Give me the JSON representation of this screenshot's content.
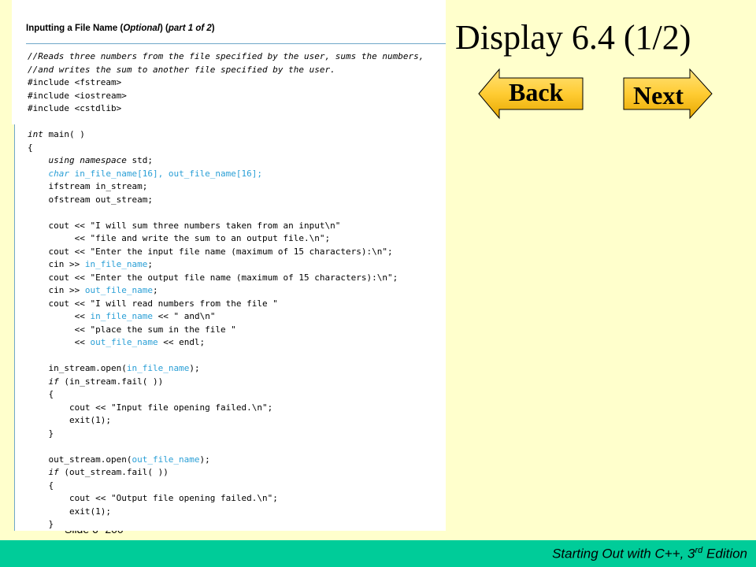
{
  "slide": {
    "number_label": "Slide 6- 200",
    "title": "Display 6.4 (1/2)",
    "back_label": "Back",
    "next_label": "Next"
  },
  "footer": {
    "text_main": "Starting Out with C++, 3",
    "text_sup": "rd",
    "text_end": " Edition"
  },
  "colors": {
    "slide_background": "#FFFFCC",
    "footer_band": "#00CC99",
    "button_fill": "#FFCC33",
    "code_highlight": "#2a9fd6",
    "rule": "#6fa7c9"
  },
  "icons": {
    "back_button_shape": "left-arrow-icon",
    "next_button_shape": "right-arrow-icon"
  },
  "panel": {
    "title_plain": "Inputting a File Name ",
    "title_paren_open": "(",
    "title_optional": "Optional",
    "title_paren_close": ") (",
    "title_part": "part 1 of 2",
    "title_end": ")"
  },
  "code_lines": [
    [
      {
        "t": "//Reads three numbers from the file specified by the user, sums the numbers,",
        "s": "kw"
      }
    ],
    [
      {
        "t": "//and writes the sum to another file specified by the user.",
        "s": "kw"
      }
    ],
    [
      {
        "t": "#include <fstream>"
      }
    ],
    [
      {
        "t": "#include <iostream>"
      }
    ],
    [
      {
        "t": "#include <cstdlib>"
      }
    ],
    [],
    [
      {
        "t": "int",
        "s": "kw"
      },
      {
        "t": " main( )"
      }
    ],
    [
      {
        "t": "{"
      }
    ],
    [
      {
        "t": "    "
      },
      {
        "t": "using namespace",
        "s": "kw"
      },
      {
        "t": " std;"
      }
    ],
    [
      {
        "t": "    "
      },
      {
        "t": "char",
        "s": "hl kw"
      },
      {
        "t": " in_file_name[16], out_file_name[16];",
        "s": "hl"
      }
    ],
    [
      {
        "t": "    ifstream in_stream;"
      }
    ],
    [
      {
        "t": "    ofstream out_stream;"
      }
    ],
    [],
    [
      {
        "t": "    cout << \"I will sum three numbers taken from an input\\n\""
      }
    ],
    [
      {
        "t": "         << \"file and write the sum to an output file.\\n\";"
      }
    ],
    [
      {
        "t": "    cout << \"Enter the input file name (maximum of 15 characters):\\n\";"
      }
    ],
    [
      {
        "t": "    cin >> "
      },
      {
        "t": "in_file_name",
        "s": "hl"
      },
      {
        "t": ";"
      }
    ],
    [
      {
        "t": "    cout << \"Enter the output file name (maximum of 15 characters):\\n\";"
      }
    ],
    [
      {
        "t": "    cin >> "
      },
      {
        "t": "out_file_name",
        "s": "hl"
      },
      {
        "t": ";"
      }
    ],
    [
      {
        "t": "    cout << \"I will read numbers from the file \""
      }
    ],
    [
      {
        "t": "         << "
      },
      {
        "t": "in_file_name",
        "s": "hl"
      },
      {
        "t": " << \" and\\n\""
      }
    ],
    [
      {
        "t": "         << \"place the sum in the file \""
      }
    ],
    [
      {
        "t": "         << "
      },
      {
        "t": "out_file_name",
        "s": "hl"
      },
      {
        "t": " << endl;"
      }
    ],
    [],
    [
      {
        "t": "    in_stream.open("
      },
      {
        "t": "in_file_name",
        "s": "hl"
      },
      {
        "t": ");"
      }
    ],
    [
      {
        "t": "    "
      },
      {
        "t": "if",
        "s": "kw"
      },
      {
        "t": " (in_stream.fail( ))"
      }
    ],
    [
      {
        "t": "    {"
      }
    ],
    [
      {
        "t": "        cout << \"Input file opening failed.\\n\";"
      }
    ],
    [
      {
        "t": "        exit(1);"
      }
    ],
    [
      {
        "t": "    }"
      }
    ],
    [],
    [
      {
        "t": "    out_stream.open("
      },
      {
        "t": "out_file_name",
        "s": "hl"
      },
      {
        "t": ");"
      }
    ],
    [
      {
        "t": "    "
      },
      {
        "t": "if",
        "s": "kw"
      },
      {
        "t": " (out_stream.fail( ))"
      }
    ],
    [
      {
        "t": "    {"
      }
    ],
    [
      {
        "t": "        cout << \"Output file opening failed.\\n\";"
      }
    ],
    [
      {
        "t": "        exit(1);"
      }
    ],
    [
      {
        "t": "    }"
      }
    ]
  ]
}
